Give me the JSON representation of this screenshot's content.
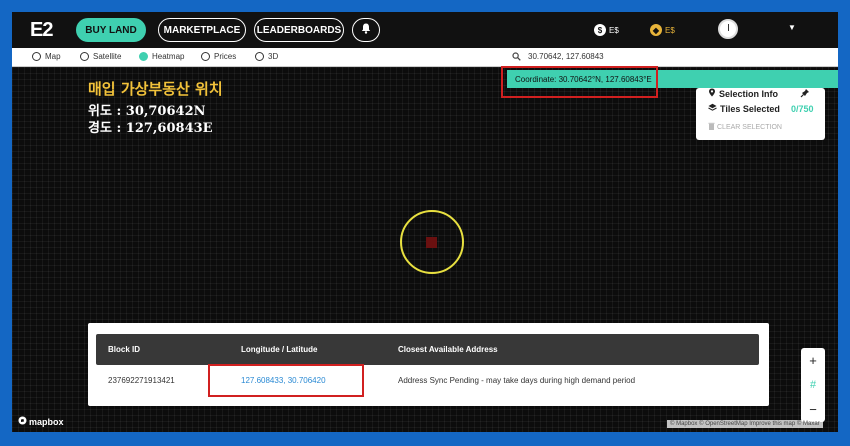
{
  "app": {
    "logo": "E2"
  },
  "nav": {
    "buy_land": "BUY LAND",
    "marketplace": "MARKETPLACE",
    "leaderboards": "LEADERBOARDS",
    "es_balance": "E$",
    "gold_balance": "E$"
  },
  "modes": [
    {
      "label": "Map",
      "selected": false
    },
    {
      "label": "Satellite",
      "selected": false
    },
    {
      "label": "Heatmap",
      "selected": true
    },
    {
      "label": "Prices",
      "selected": false
    },
    {
      "label": "3D",
      "selected": false
    }
  ],
  "search": {
    "value": "30.70642, 127.60843"
  },
  "coordinate_banner": "Coordinate: 30.70642°N, 127.60843°E",
  "overlay": {
    "title": "매입 가상부동산 위치",
    "lat_line": "위도 : 30,70642N",
    "lng_line": "경도 : 127,60843E"
  },
  "selection_panel": {
    "title": "Selection Info",
    "tiles_label": "Tiles Selected",
    "tiles_value": "0/750",
    "clear_label": "CLEAR SELECTION"
  },
  "table": {
    "headers": [
      "Block ID",
      "Longitude / Latitude",
      "Closest Available Address"
    ],
    "rows": [
      {
        "block_id": "237692271913421",
        "lng_lat": "127.608433, 30.706420",
        "address": "Address Sync Pending - may take days during high demand period"
      }
    ]
  },
  "zoom": {
    "in": "+",
    "grid": "#",
    "out": "−"
  },
  "map_footer": {
    "logo": "mapbox",
    "attribution": "© Mapbox © OpenStreetMap Improve this map © Maxar"
  },
  "colors": {
    "accent": "#3fd0b0",
    "highlight": "#d12020",
    "gold": "#e8b43a"
  }
}
